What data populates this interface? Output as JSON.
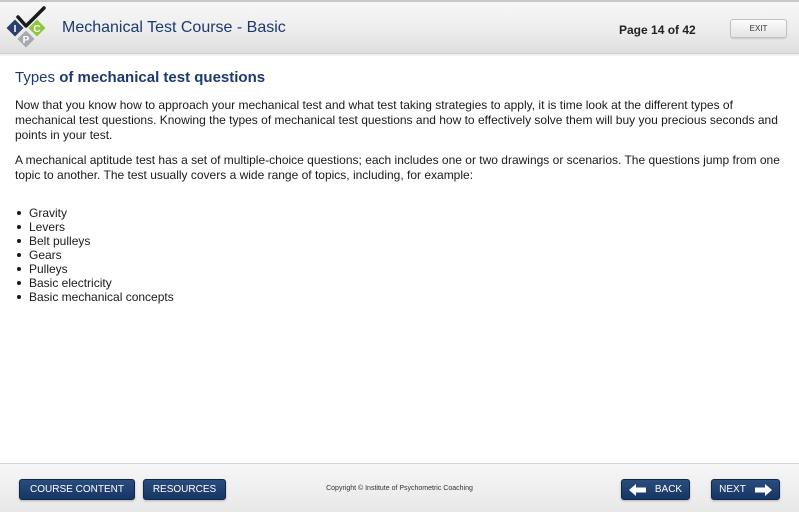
{
  "header": {
    "logo_letters": [
      "I",
      "P",
      "C"
    ],
    "course_title": "Mechanical Test Course - Basic",
    "page_indicator": "Page 14 of 42",
    "exit_label": "EXIT"
  },
  "content": {
    "title_light": "Types",
    "title_bold": " of mechanical test questions",
    "paragraphs": [
      "Now that you know how to approach your mechanical test and what test taking strategies to apply, it is time look at the different types of mechanical test questions. Knowing the types of mechanical test questions and how to effectively solve them will buy you precious seconds and points in your test.",
      "A mechanical aptitude test has a set of multiple-choice questions; each includes one or two drawings or scenarios. The questions jump from one topic to another. The test usually covers a wide range of topics, including, for example:"
    ],
    "topics": [
      "Gravity",
      "Levers",
      "Belt pulleys",
      "Gears",
      "Pulleys",
      "Basic electricity",
      "Basic mechanical concepts"
    ]
  },
  "footer": {
    "course_content_label": "COURSE CONTENT",
    "resources_label": "RESOURCES",
    "copyright": "Copyright © Institute of Psychometric Coaching",
    "back_label": "BACK",
    "next_label": "NEXT",
    "back_icon": "arrow-left-icon",
    "next_icon": "arrow-right-icon"
  },
  "colors": {
    "brand_navy": "#1c3a6e",
    "button_navy": "#1f4170",
    "logo_green": "#8dc63f",
    "logo_gray": "#a7a9ac",
    "logo_dark": "#2b3f6b"
  }
}
